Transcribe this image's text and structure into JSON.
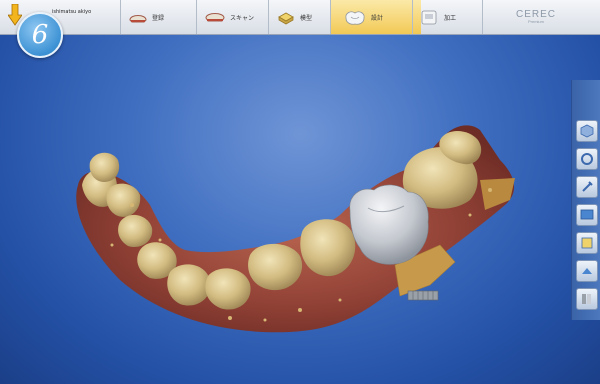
{
  "app": {
    "counter": "6",
    "patient_name": "ishimatsu akiyo",
    "brand_name": "CEREC",
    "brand_sub": "Premium"
  },
  "steps": [
    {
      "label": "登録",
      "icon": "registration-icon"
    },
    {
      "label": "スキャン",
      "icon": "scan-icon"
    },
    {
      "label": "模型",
      "icon": "model-icon"
    },
    {
      "label": "設計",
      "icon": "design-icon",
      "active": true
    },
    {
      "label": "加工",
      "icon": "milling-icon"
    }
  ],
  "right_tools": [
    "cube-view-icon",
    "rotate-icon",
    "tools-icon",
    "display-icon",
    "analysis-icon",
    "settings-icon",
    "library-icon"
  ],
  "colors": {
    "background": "#3f6ec0",
    "active_step": "#f2c955",
    "tooth": "#d9c48c",
    "gum": "#a04e3c",
    "crown": "#c9cdd3"
  }
}
